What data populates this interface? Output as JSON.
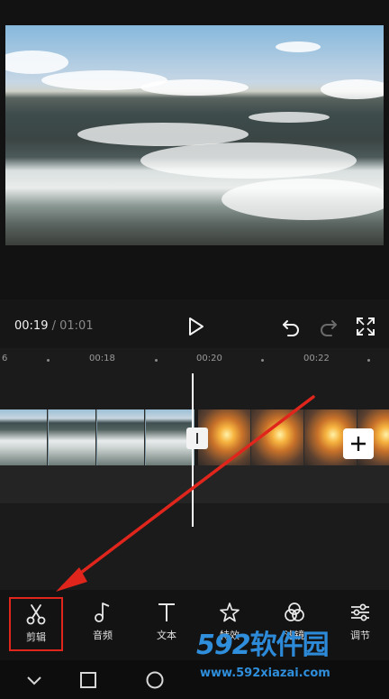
{
  "player": {
    "current_time": "00:19",
    "separator": " / ",
    "total_time": "01:01"
  },
  "ruler": {
    "labels": [
      "00:18",
      "00:20",
      "00:22"
    ],
    "edge_label": "6"
  },
  "toolbar": {
    "items": [
      {
        "label": "剪辑",
        "icon": "scissors-icon"
      },
      {
        "label": "音频",
        "icon": "music-note-icon"
      },
      {
        "label": "文本",
        "icon": "text-icon"
      },
      {
        "label": "特效",
        "icon": "star-effects-icon"
      },
      {
        "label": "滤镜",
        "icon": "filter-circles-icon"
      },
      {
        "label": "调节",
        "icon": "sliders-icon"
      }
    ]
  },
  "watermark": {
    "brand_number": "592",
    "brand_text": "软件园",
    "url": "www.592xiazai.com"
  },
  "colors": {
    "highlight_box": "#e0261c",
    "arrow": "#e0261c",
    "watermark": "#2f8fdc"
  }
}
